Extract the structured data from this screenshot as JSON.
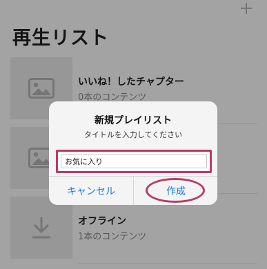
{
  "header": {
    "title": "再生リスト",
    "add_icon": "plus-icon"
  },
  "playlists": [
    {
      "title": "いいね！したチャプター",
      "subtitle": "0本のコンテンツ",
      "icon": "image-placeholder-icon"
    },
    {
      "title": "",
      "subtitle": "",
      "icon": "image-placeholder-icon"
    },
    {
      "title": "オフライン",
      "subtitle": "1本のコンテンツ",
      "icon": "download-icon"
    }
  ],
  "dialog": {
    "title": "新規プレイリスト",
    "message": "タイトルを入力してください",
    "input_value": "お気に入り",
    "cancel_label": "キャンセル",
    "create_label": "作成"
  },
  "colors": {
    "highlight": "#b83b63",
    "button_text": "#1f7ae0",
    "overlay": "rgba(0,0,0,0.36)"
  }
}
